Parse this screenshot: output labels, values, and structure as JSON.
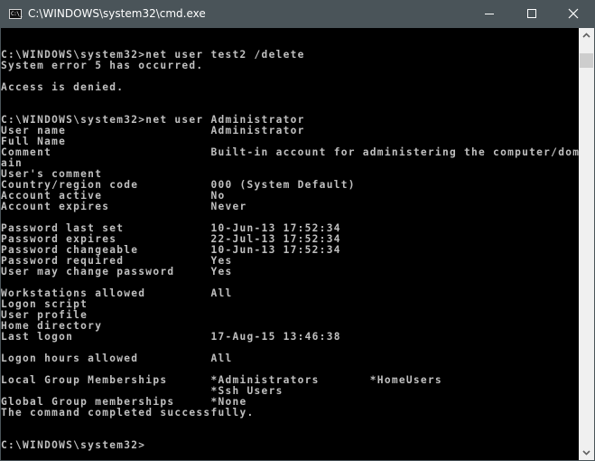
{
  "window": {
    "title": "C:\\WINDOWS\\system32\\cmd.exe",
    "icon": "cmd-icon",
    "icon_text": "C:\\_",
    "controls": {
      "minimize": "minimize-icon",
      "maximize": "maximize-icon",
      "close": "close-icon"
    }
  },
  "console": {
    "lines": [
      "",
      "C:\\WINDOWS\\system32>net user test2 /delete",
      "System error 5 has occurred.",
      "",
      "Access is denied.",
      "",
      "",
      "C:\\WINDOWS\\system32>net user Administrator",
      "User name                    Administrator",
      "Full Name",
      "Comment                      Built-in account for administering the computer/dom",
      "ain",
      "User's comment",
      "Country/region code          000 (System Default)",
      "Account active               No",
      "Account expires              Never",
      "",
      "Password last set            10-Jun-13 17:52:34",
      "Password expires             22-Jul-13 17:52:34",
      "Password changeable          10-Jun-13 17:52:34",
      "Password required            Yes",
      "User may change password     Yes",
      "",
      "Workstations allowed         All",
      "Logon script",
      "User profile",
      "Home directory",
      "Last logon                   17-Aug-15 13:46:38",
      "",
      "Logon hours allowed          All",
      "",
      "Local Group Memberships      *Administrators       *HomeUsers",
      "                             *Ssh Users",
      "Global Group memberships     *None",
      "The command completed successfully.",
      "",
      "",
      "C:\\WINDOWS\\system32>"
    ]
  },
  "scrollbar": {
    "up_icon": "chevron-up-icon",
    "down_icon": "chevron-down-icon"
  }
}
